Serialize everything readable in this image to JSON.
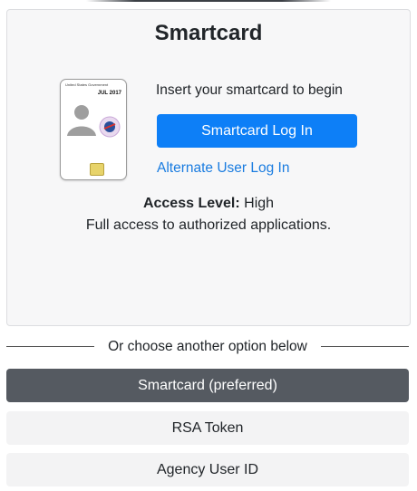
{
  "card": {
    "title": "Smartcard",
    "prompt": "Insert your smartcard to begin",
    "login_button": "Smartcard Log In",
    "alternate_link": "Alternate User Log In",
    "access_label": "Access Level:",
    "access_value": "High",
    "access_description": "Full access to authorized applications.",
    "badge": {
      "government": "United States Government",
      "date": "JUL 2017"
    }
  },
  "divider_text": "Or choose another option below",
  "options": [
    {
      "label": "Smartcard (preferred)"
    },
    {
      "label": "RSA Token"
    },
    {
      "label": "Agency User ID"
    }
  ],
  "colors": {
    "primary": "#0d7ff7",
    "selected_option": "#555a61",
    "option_bg": "#f3f3f4",
    "link": "#1a7ce0"
  }
}
